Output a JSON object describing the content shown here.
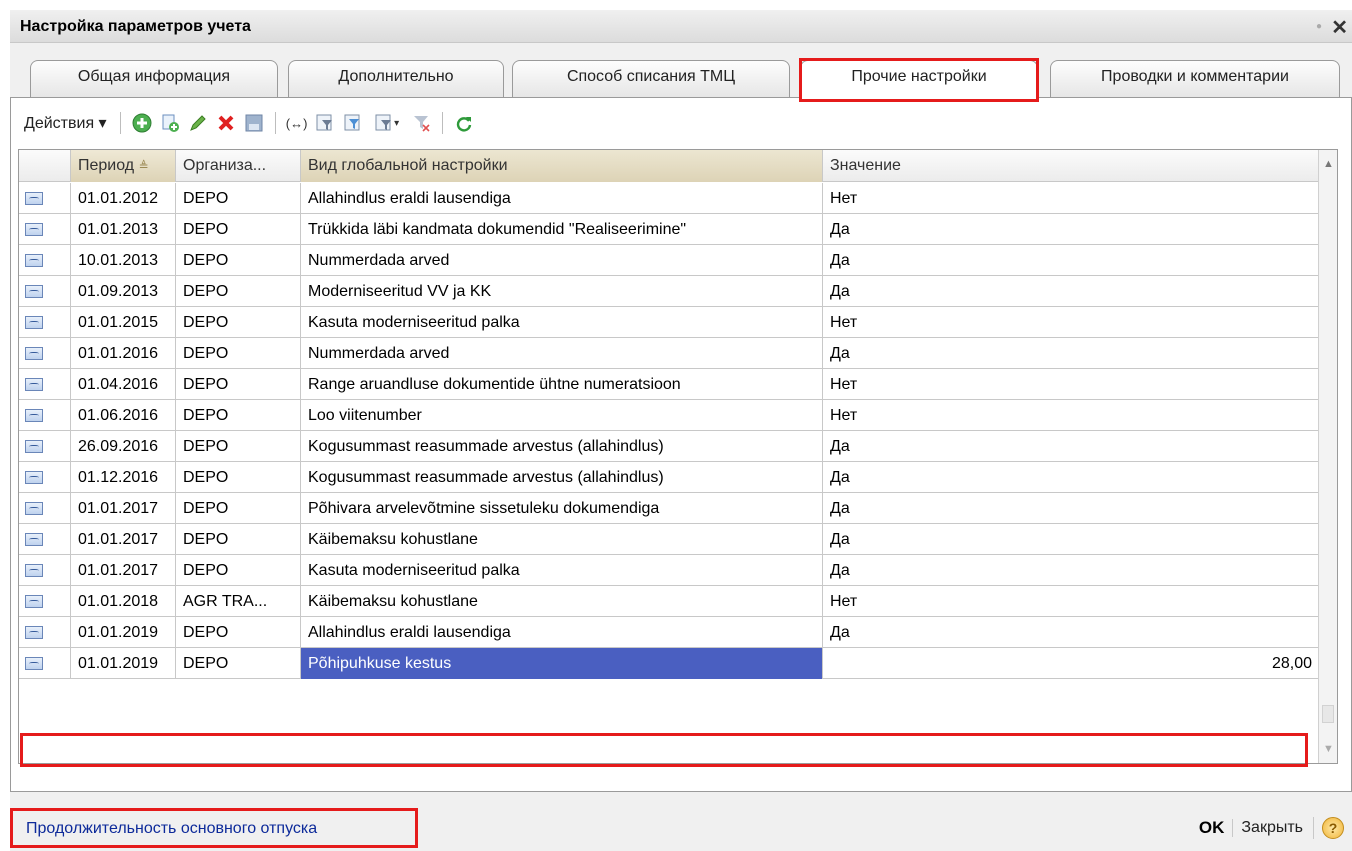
{
  "window": {
    "title": "Настройка параметров учета"
  },
  "tabs": [
    {
      "label": "Общая информация"
    },
    {
      "label": "Дополнительно"
    },
    {
      "label": "Способ списания ТМЦ"
    },
    {
      "label": "Прочие настройки",
      "active": true
    },
    {
      "label": "Проводки и комментарии"
    }
  ],
  "toolbar": {
    "actions_label": "Действия",
    "icons": [
      "add-icon",
      "copy-icon",
      "edit-icon",
      "delete-icon",
      "save-icon",
      "sort-icon",
      "filter-icon",
      "filter-selection-icon",
      "filter-list-icon",
      "clear-filter-icon",
      "refresh-icon"
    ]
  },
  "grid": {
    "columns": [
      "",
      "Период",
      "Организа...",
      "Вид глобальной настройки",
      "Значение"
    ],
    "rows": [
      {
        "period": "01.01.2012",
        "org": "DEPO",
        "setting": "Allahindlus eraldi lausendiga",
        "value": "Нет"
      },
      {
        "period": "01.01.2013",
        "org": "DEPO",
        "setting": "Trükkida läbi kandmata dokumendid \"Realiseerimine\"",
        "value": "Да"
      },
      {
        "period": "10.01.2013",
        "org": "DEPO",
        "setting": "Nummerdada arved",
        "value": "Да"
      },
      {
        "period": "01.09.2013",
        "org": "DEPO",
        "setting": "Moderniseeritud VV ja KK",
        "value": "Да"
      },
      {
        "period": "01.01.2015",
        "org": "DEPO",
        "setting": "Kasuta moderniseeritud palka",
        "value": "Нет"
      },
      {
        "period": "01.01.2016",
        "org": "DEPO",
        "setting": "Nummerdada arved",
        "value": "Да"
      },
      {
        "period": "01.04.2016",
        "org": "DEPO",
        "setting": "Range aruandluse dokumentide ühtne numeratsioon",
        "value": "Нет"
      },
      {
        "period": "01.06.2016",
        "org": "DEPO",
        "setting": "Loo viitenumber",
        "value": "Нет"
      },
      {
        "period": "26.09.2016",
        "org": "DEPO",
        "setting": "Kogusummast reasummade arvestus (allahindlus)",
        "value": "Да"
      },
      {
        "period": "01.12.2016",
        "org": "DEPO",
        "setting": "Kogusummast reasummade arvestus (allahindlus)",
        "value": "Да"
      },
      {
        "period": "01.01.2017",
        "org": "DEPO",
        "setting": "Põhivara arvelevõtmine sissetuleku dokumendiga",
        "value": "Да"
      },
      {
        "period": "01.01.2017",
        "org": "DEPO",
        "setting": "Käibemaksu kohustlane",
        "value": "Да"
      },
      {
        "period": "01.01.2017",
        "org": "DEPO",
        "setting": "Kasuta moderniseeritud palka",
        "value": "Да"
      },
      {
        "period": "01.01.2018",
        "org": "AGR TRA...",
        "setting": "Käibemaksu kohustlane",
        "value": "Нет"
      },
      {
        "period": "01.01.2019",
        "org": "DEPO",
        "setting": "Allahindlus eraldi lausendiga",
        "value": "Да"
      },
      {
        "period": "01.01.2019",
        "org": "DEPO",
        "setting": "Põhipuhkuse kestus",
        "value": "28,00",
        "selected": true
      }
    ]
  },
  "status": {
    "text": "Продолжительность основного отпуска"
  },
  "buttons": {
    "ok": "OK",
    "close": "Закрыть",
    "help": "?"
  },
  "colors": {
    "highlight_frame": "#e51b1b",
    "selection": "#4a5fc1",
    "status_text": "#0d2a9a"
  }
}
